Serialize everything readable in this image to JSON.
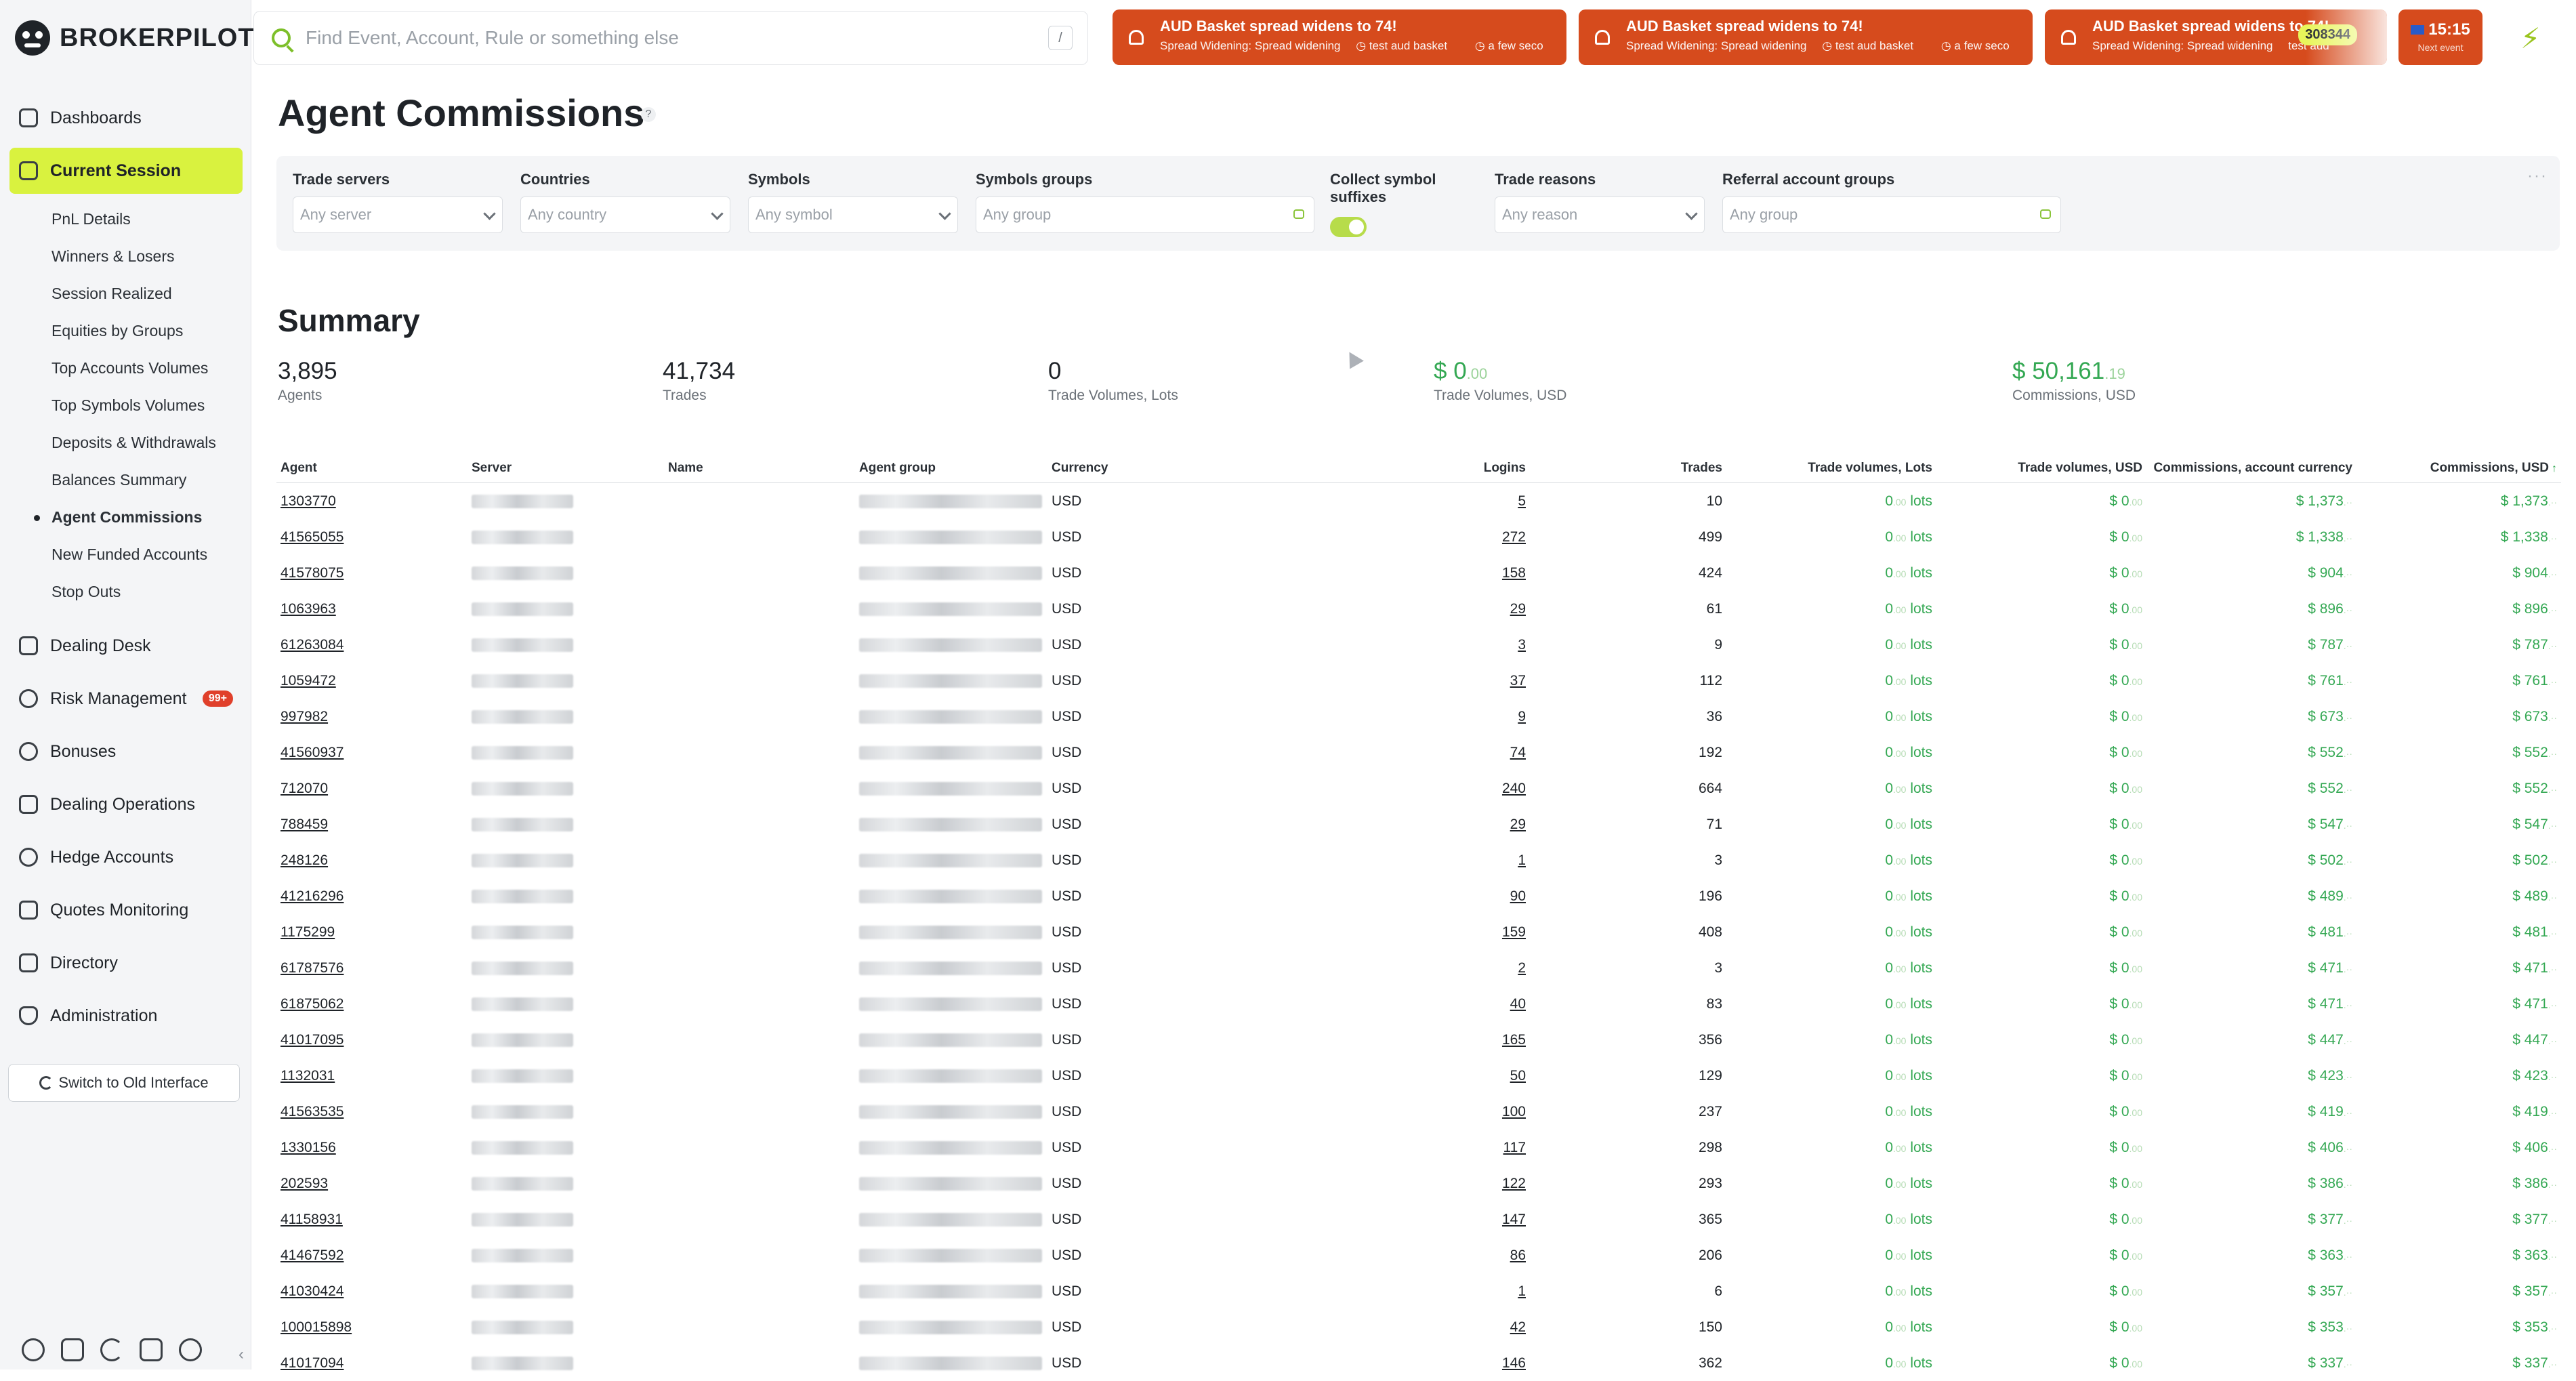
{
  "brand": "BROKERPILOT",
  "search": {
    "placeholder": "Find Event, Account, Rule or something else",
    "shortcut": "/"
  },
  "alerts": [
    {
      "title": "AUD Basket spread widens to 74!",
      "type": "Spread Widening: Spread widening",
      "tag": "test aud basket",
      "time": "a few seco"
    },
    {
      "title": "AUD Basket spread widens to 74!",
      "type": "Spread Widening: Spread widening",
      "tag": "test aud basket",
      "time": "a few seco"
    },
    {
      "title": "AUD Basket spread widens to 74!",
      "type": "Spread Widening: Spread widening",
      "tag": "test aud",
      "time": "",
      "count": "308344"
    }
  ],
  "clock": {
    "time": "15:15",
    "next": "Next event"
  },
  "sidebar": {
    "items": [
      {
        "label": "Dashboards"
      },
      {
        "label": "Current Session"
      },
      {
        "label": "Dealing Desk"
      },
      {
        "label": "Risk Management",
        "badge": "99+"
      },
      {
        "label": "Bonuses"
      },
      {
        "label": "Dealing Operations"
      },
      {
        "label": "Hedge Accounts"
      },
      {
        "label": "Quotes Monitoring"
      },
      {
        "label": "Directory"
      },
      {
        "label": "Administration"
      }
    ],
    "sub_items": [
      "PnL Details",
      "Winners & Losers",
      "Session Realized",
      "Equities by Groups",
      "Top Accounts Volumes",
      "Top Symbols Volumes",
      "Deposits & Withdrawals",
      "Balances Summary",
      "Agent Commissions",
      "New Funded Accounts",
      "Stop Outs"
    ],
    "old_interface": "Switch to Old Interface"
  },
  "page": {
    "title": "Agent Commissions",
    "help": "?"
  },
  "filters": {
    "trade_servers": {
      "label": "Trade servers",
      "placeholder": "Any server"
    },
    "countries": {
      "label": "Countries",
      "placeholder": "Any country"
    },
    "symbols": {
      "label": "Symbols",
      "placeholder": "Any symbol"
    },
    "symbols_groups": {
      "label": "Symbols groups",
      "placeholder": "Any group"
    },
    "collect_suffixes": {
      "label": "Collect symbol suffixes",
      "enabled": true
    },
    "trade_reasons": {
      "label": "Trade reasons",
      "placeholder": "Any reason"
    },
    "referral_groups": {
      "label": "Referral account groups",
      "placeholder": "Any group"
    }
  },
  "summary": {
    "title": "Summary",
    "agents": {
      "value": "3,895",
      "label": "Agents"
    },
    "trades": {
      "value": "41,734",
      "label": "Trades"
    },
    "volumes_lots": {
      "value": "0",
      "label": "Trade Volumes, Lots"
    },
    "volumes_usd": {
      "value": "$ 0",
      "cents": ".00",
      "label": "Trade Volumes, USD"
    },
    "commissions": {
      "value": "$ 50,161",
      "cents": ".19",
      "label": "Commissions, USD"
    }
  },
  "table": {
    "columns": [
      "Agent",
      "Server",
      "Name",
      "Agent group",
      "Currency",
      "Logins",
      "Trades",
      "Trade volumes, Lots",
      "Trade volumes, USD",
      "Commissions, account currency",
      "Commissions, USD"
    ],
    "lots_unit": "lots",
    "rows": [
      {
        "agent": "1303770",
        "currency": "USD",
        "logins": "5",
        "trades": "10",
        "lots": "0",
        "usd": "$ 0",
        "comm": "$ 1,373",
        "comm_usd": "$ 1,373"
      },
      {
        "agent": "41565055",
        "currency": "USD",
        "logins": "272",
        "trades": "499",
        "lots": "0",
        "usd": "$ 0",
        "comm": "$ 1,338",
        "comm_usd": "$ 1,338"
      },
      {
        "agent": "41578075",
        "currency": "USD",
        "logins": "158",
        "trades": "424",
        "lots": "0",
        "usd": "$ 0",
        "comm": "$ 904",
        "comm_usd": "$ 904"
      },
      {
        "agent": "1063963",
        "currency": "USD",
        "logins": "29",
        "trades": "61",
        "lots": "0",
        "usd": "$ 0",
        "comm": "$ 896",
        "comm_usd": "$ 896"
      },
      {
        "agent": "61263084",
        "currency": "USD",
        "logins": "3",
        "trades": "9",
        "lots": "0",
        "usd": "$ 0",
        "comm": "$ 787",
        "comm_usd": "$ 787"
      },
      {
        "agent": "1059472",
        "currency": "USD",
        "logins": "37",
        "trades": "112",
        "lots": "0",
        "usd": "$ 0",
        "comm": "$ 761",
        "comm_usd": "$ 761"
      },
      {
        "agent": "997982",
        "currency": "USD",
        "logins": "9",
        "trades": "36",
        "lots": "0",
        "usd": "$ 0",
        "comm": "$ 673",
        "comm_usd": "$ 673"
      },
      {
        "agent": "41560937",
        "currency": "USD",
        "logins": "74",
        "trades": "192",
        "lots": "0",
        "usd": "$ 0",
        "comm": "$ 552",
        "comm_usd": "$ 552"
      },
      {
        "agent": "712070",
        "currency": "USD",
        "logins": "240",
        "trades": "664",
        "lots": "0",
        "usd": "$ 0",
        "comm": "$ 552",
        "comm_usd": "$ 552"
      },
      {
        "agent": "788459",
        "currency": "USD",
        "logins": "29",
        "trades": "71",
        "lots": "0",
        "usd": "$ 0",
        "comm": "$ 547",
        "comm_usd": "$ 547"
      },
      {
        "agent": "248126",
        "currency": "USD",
        "logins": "1",
        "trades": "3",
        "lots": "0",
        "usd": "$ 0",
        "comm": "$ 502",
        "comm_usd": "$ 502"
      },
      {
        "agent": "41216296",
        "currency": "USD",
        "logins": "90",
        "trades": "196",
        "lots": "0",
        "usd": "$ 0",
        "comm": "$ 489",
        "comm_usd": "$ 489"
      },
      {
        "agent": "1175299",
        "currency": "USD",
        "logins": "159",
        "trades": "408",
        "lots": "0",
        "usd": "$ 0",
        "comm": "$ 481",
        "comm_usd": "$ 481"
      },
      {
        "agent": "61787576",
        "currency": "USD",
        "logins": "2",
        "trades": "3",
        "lots": "0",
        "usd": "$ 0",
        "comm": "$ 471",
        "comm_usd": "$ 471"
      },
      {
        "agent": "61875062",
        "currency": "USD",
        "logins": "40",
        "trades": "83",
        "lots": "0",
        "usd": "$ 0",
        "comm": "$ 471",
        "comm_usd": "$ 471"
      },
      {
        "agent": "41017095",
        "currency": "USD",
        "logins": "165",
        "trades": "356",
        "lots": "0",
        "usd": "$ 0",
        "comm": "$ 447",
        "comm_usd": "$ 447"
      },
      {
        "agent": "1132031",
        "currency": "USD",
        "logins": "50",
        "trades": "129",
        "lots": "0",
        "usd": "$ 0",
        "comm": "$ 423",
        "comm_usd": "$ 423"
      },
      {
        "agent": "41563535",
        "currency": "USD",
        "logins": "100",
        "trades": "237",
        "lots": "0",
        "usd": "$ 0",
        "comm": "$ 419",
        "comm_usd": "$ 419"
      },
      {
        "agent": "1330156",
        "currency": "USD",
        "logins": "117",
        "trades": "298",
        "lots": "0",
        "usd": "$ 0",
        "comm": "$ 406",
        "comm_usd": "$ 406"
      },
      {
        "agent": "202593",
        "currency": "USD",
        "logins": "122",
        "trades": "293",
        "lots": "0",
        "usd": "$ 0",
        "comm": "$ 386",
        "comm_usd": "$ 386"
      },
      {
        "agent": "41158931",
        "currency": "USD",
        "logins": "147",
        "trades": "365",
        "lots": "0",
        "usd": "$ 0",
        "comm": "$ 377",
        "comm_usd": "$ 377"
      },
      {
        "agent": "41467592",
        "currency": "USD",
        "logins": "86",
        "trades": "206",
        "lots": "0",
        "usd": "$ 0",
        "comm": "$ 363",
        "comm_usd": "$ 363"
      },
      {
        "agent": "41030424",
        "currency": "USD",
        "logins": "1",
        "trades": "6",
        "lots": "0",
        "usd": "$ 0",
        "comm": "$ 357",
        "comm_usd": "$ 357"
      },
      {
        "agent": "100015898",
        "currency": "USD",
        "logins": "42",
        "trades": "150",
        "lots": "0",
        "usd": "$ 0",
        "comm": "$ 353",
        "comm_usd": "$ 353"
      },
      {
        "agent": "41017094",
        "currency": "USD",
        "logins": "146",
        "trades": "362",
        "lots": "0",
        "usd": "$ 0",
        "comm": "$ 337",
        "comm_usd": "$ 337"
      }
    ]
  }
}
